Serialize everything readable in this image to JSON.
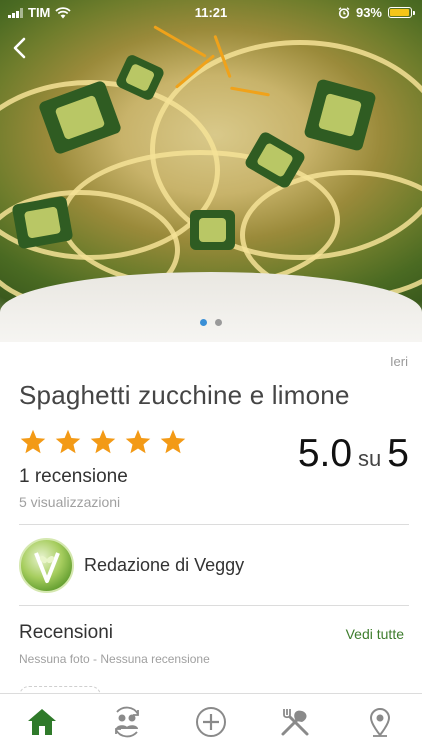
{
  "status_bar": {
    "carrier": "TIM",
    "time": "11:21",
    "battery": "93%",
    "battery_level": 0.93
  },
  "carousel": {
    "pages": 2,
    "active_index": 0
  },
  "recipe": {
    "date": "Ieri",
    "title": "Spaghetti zucchine e limone",
    "rating_stars": 5,
    "score": "5.0",
    "score_connector": "su",
    "score_max": "5",
    "review_count": "1 recensione",
    "views": "5 visualizzazioni"
  },
  "author": {
    "name": "Redazione di Veggy"
  },
  "reviews": {
    "title": "Recensioni",
    "see_all": "Vedi tutte",
    "subtitle": "Nessuna foto - Nessuna recensione"
  },
  "tabbar": {
    "items": [
      "home-icon",
      "users-sync-icon",
      "plus-circle-icon",
      "utensils-icon",
      "map-pin-icon"
    ],
    "active": "home-icon"
  },
  "colors": {
    "accent_green": "#3e7d2d",
    "star_orange": "#f39a16",
    "active_dot": "#3a8fd6",
    "battery_yellow": "#f5c518"
  }
}
